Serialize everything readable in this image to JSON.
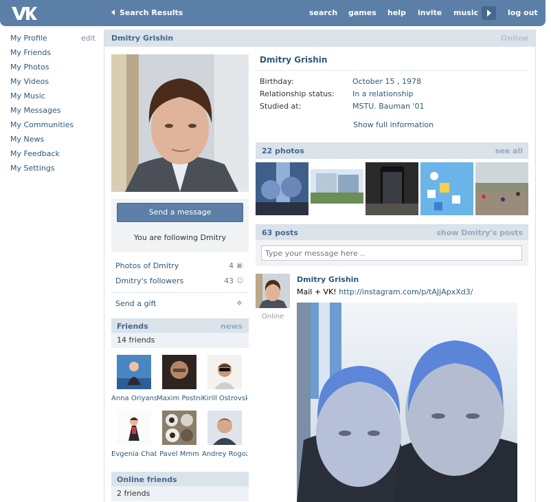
{
  "header": {
    "back_label": "Search Results",
    "nav": [
      "search",
      "games",
      "help",
      "invite",
      "music"
    ],
    "logout": "log out"
  },
  "leftmenu": {
    "edit": "edit",
    "items": [
      "My Profile",
      "My Friends",
      "My Photos",
      "My Videos",
      "My Music",
      "My Messages",
      "My Communities",
      "My News",
      "My Feedback",
      "My Settings"
    ]
  },
  "profile": {
    "name": "Dmitry Grishin",
    "status": "Online",
    "send_message": "Send a message",
    "following": "You are following Dmitry",
    "photos_of": {
      "label": "Photos of Dmitry",
      "count": "4"
    },
    "followers": {
      "label": "Dmitry's followers",
      "count": "43"
    },
    "send_gift": "Send a gift",
    "info": [
      {
        "key": "Birthday:",
        "value": "October 15 , 1978"
      },
      {
        "key": "Relationship status:",
        "value": "In a relationship"
      },
      {
        "key": "Studied at:",
        "value": "MSTU. Bauman '01"
      }
    ],
    "show_full": "Show full information"
  },
  "friends": {
    "title": "Friends",
    "link": "news",
    "count": "14 friends",
    "items": [
      "Anna Oriyanskaya",
      "Maxim Postnikov",
      "Kirill Ostrovsky",
      "Evgenia Chabanenko",
      "Pavel Mmm",
      "Andrey Rogozov"
    ]
  },
  "online_friends": {
    "title": "Online friends",
    "count": "2 friends"
  },
  "photos": {
    "title": "22 photos",
    "link": "see all"
  },
  "posts": {
    "title": "63 posts",
    "link": "show Dmitry's posts",
    "placeholder": "Type your message here ..",
    "author": "Dmitry Grishin",
    "text": "Mail + VK!",
    "url": "http://instagram.com/p/tAJjApxXd3/",
    "online": "Online"
  },
  "colors": {
    "header": "#5b7fa6",
    "link": "#2b587a",
    "blockhead": "#dae2ea"
  }
}
